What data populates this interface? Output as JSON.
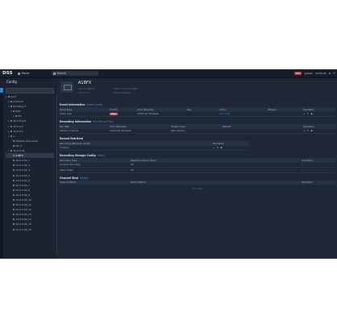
{
  "app": {
    "logo": "DSS",
    "tabs": {
      "home": "Home",
      "search": "Search"
    }
  },
  "tray": {
    "rec": "REC",
    "user": "system",
    "time": "12:00:00"
  },
  "config": {
    "title": "Config"
  },
  "sidebar": {
    "search_placeholder": "",
    "tree": [
      {
        "label": "Root",
        "level": 0,
        "tri": "▾"
      },
      {
        "label": "Ambient",
        "level": 1,
        "tri": "▸"
      },
      {
        "label": "Building IT",
        "level": 1,
        "tri": "▾"
      },
      {
        "label": "NVR",
        "level": 2,
        "tri": "▾"
      },
      {
        "label": "IPC",
        "level": 3,
        "tri": "▸"
      },
      {
        "label": "10.0.0.101",
        "level": 1,
        "tri": "▸"
      },
      {
        "label": "10.0.0.4",
        "level": 1,
        "tri": "▸"
      },
      {
        "label": "10.0.0.2",
        "level": 1,
        "tri": "▸"
      },
      {
        "label": "x",
        "level": 1,
        "tri": "▾"
      },
      {
        "label": "Website Download",
        "level": 2,
        "tri": ""
      },
      {
        "label": "IPC_1",
        "level": 2,
        "tri": ""
      },
      {
        "label": "10.0.0.34",
        "level": 1,
        "tri": "▾"
      },
      {
        "label": "A1BFX",
        "level": 2,
        "tri": "",
        "selected": true
      },
      {
        "label": "10.0.0.34_2",
        "level": 2,
        "tri": ""
      },
      {
        "label": "10.0.0.34_3",
        "level": 2,
        "tri": ""
      },
      {
        "label": "10.0.0.34_4",
        "level": 2,
        "tri": ""
      },
      {
        "label": "10.0.0.34_5",
        "level": 2,
        "tri": ""
      },
      {
        "label": "10.0.0.34_6",
        "level": 2,
        "tri": ""
      },
      {
        "label": "10.0.0.34_7",
        "level": 2,
        "tri": ""
      },
      {
        "label": "10.0.0.34_8",
        "level": 2,
        "tri": ""
      },
      {
        "label": "10.0.0.34_9",
        "level": 2,
        "tri": ""
      },
      {
        "label": "10.0.0.34_10",
        "level": 2,
        "tri": ""
      },
      {
        "label": "10.0.0.34_11",
        "level": 2,
        "tri": ""
      },
      {
        "label": "10.0.0.34_12",
        "level": 2,
        "tri": ""
      },
      {
        "label": "10.0.0.34_13",
        "level": 2,
        "tri": ""
      },
      {
        "label": "10.0.0.34_14",
        "level": 2,
        "tri": ""
      },
      {
        "label": "10.0.0.34_15",
        "level": 2,
        "tri": ""
      },
      {
        "label": "10.0.0.34_16",
        "level": 2,
        "tri": ""
      }
    ]
  },
  "device": {
    "name": "A1BFX",
    "k1": "Device Name",
    "k2": "10.0.0.34",
    "k3": "Video Channel Type",
    "k4": "Fixed Camera"
  },
  "event": {
    "title": "Event Information",
    "link": "Event Config",
    "headers": [
      "Event Type",
      "Priority",
      "Time Template",
      "Tag",
      "Action",
      "Remark",
      "Operation"
    ],
    "row": {
      "type": "Video Loss",
      "priority": "High",
      "template": "All-Period Template",
      "tag": "",
      "action": "Link Alert",
      "remark": ""
    }
  },
  "recording": {
    "title": "Recording Information",
    "link": "Add Record Plan",
    "headers": [
      "Rec Path",
      "Time Template",
      "Stream Type",
      "Remark",
      "Operation"
    ],
    "row": {
      "path": "Stored on Server",
      "template": "All-Period Template",
      "stream": "Main Stream",
      "remark": ""
    }
  },
  "retrieval": {
    "title": "Record Retrieval",
    "headers": [
      "Recording Retrieval Length",
      "Operation"
    ],
    "row": {
      "length": "3 Day(s)"
    }
  },
  "storage": {
    "title": "Recording Storage Config",
    "link": "Modify",
    "headers": [
      "Recording Type",
      "Retention Period (Day)",
      "Operation"
    ],
    "rows": [
      {
        "type": "General Recording",
        "period": "30",
        "op": "--"
      },
      {
        "type": "Alarm Video",
        "period": "30",
        "op": "--"
      }
    ]
  },
  "channel": {
    "title": "Channel Bind",
    "link": "Modify",
    "headers": [
      "Channel Name",
      "Device Name",
      "Operation"
    ],
    "empty": "No data"
  }
}
